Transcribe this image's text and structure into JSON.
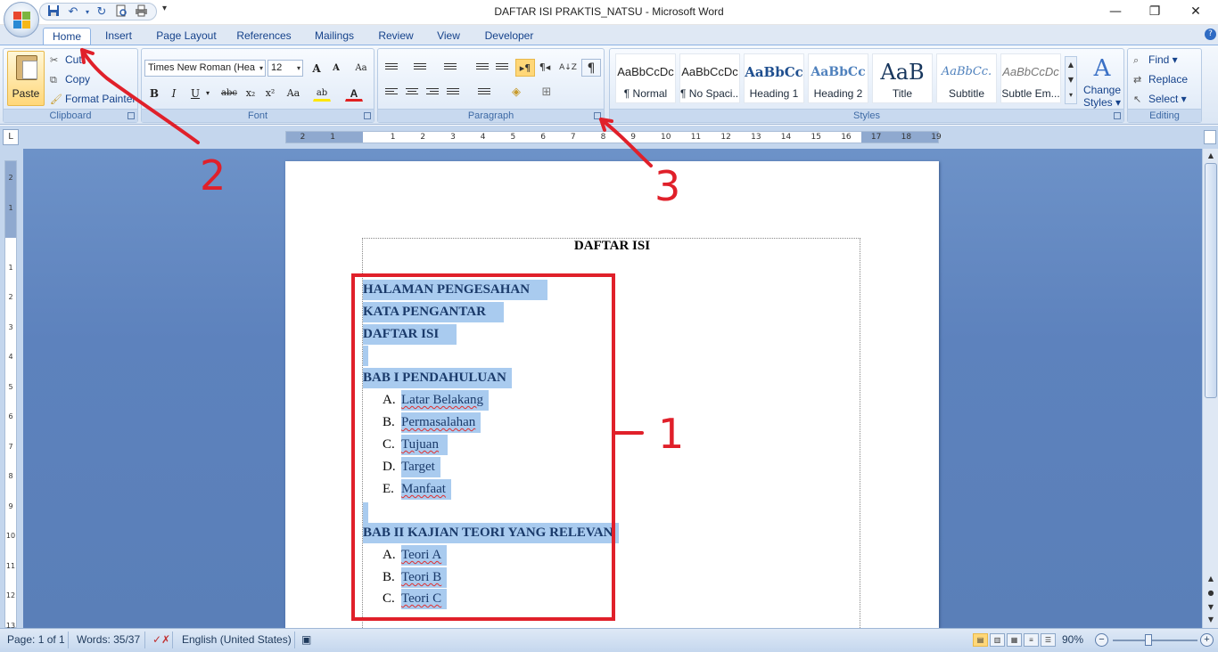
{
  "window": {
    "title": "DAFTAR ISI PRAKTIS_NATSU - Microsoft Word",
    "minimize": "—",
    "restore": "❐",
    "close": "✕"
  },
  "qat": {
    "save_icon": "save-icon",
    "undo_icon": "undo-icon",
    "redo_icon": "redo-icon",
    "print_preview_icon": "print-preview-icon",
    "print_icon": "print-icon",
    "customize": "▾"
  },
  "tabs": [
    {
      "label": "Home"
    },
    {
      "label": "Insert"
    },
    {
      "label": "Page Layout"
    },
    {
      "label": "References"
    },
    {
      "label": "Mailings"
    },
    {
      "label": "Review"
    },
    {
      "label": "View"
    },
    {
      "label": "Developer"
    }
  ],
  "help": "?",
  "ribbon": {
    "clipboard": {
      "label": "Clipboard",
      "paste": "Paste",
      "cut": "Cut",
      "copy": "Copy",
      "format_painter": "Format Painter"
    },
    "font": {
      "label": "Font",
      "font_name": "Times New Roman (Hea",
      "font_size": "12",
      "grow": "A",
      "shrink": "A",
      "clear": "Aa",
      "bold": "B",
      "italic": "I",
      "underline": "U",
      "strike": "abc",
      "subscript": "x₂",
      "superscript": "x²",
      "change_case": "Aa",
      "highlight": "ab",
      "font_color": "A"
    },
    "paragraph": {
      "label": "Paragraph",
      "show_marks": "¶",
      "sort": "A↓Z"
    },
    "styles": {
      "label": "Styles",
      "items": [
        {
          "sample": "AaBbCcDc",
          "name": "¶ Normal"
        },
        {
          "sample": "AaBbCcDc",
          "name": "¶ No Spaci..."
        },
        {
          "sample": "AaBbCc",
          "name": "Heading 1"
        },
        {
          "sample": "AaBbCc",
          "name": "Heading 2"
        },
        {
          "sample": "AaB",
          "name": "Title"
        },
        {
          "sample": "AaBbCc.",
          "name": "Subtitle"
        },
        {
          "sample": "AaBbCcDc",
          "name": "Subtle Em..."
        }
      ],
      "change_styles_line1": "Change",
      "change_styles_line2": "Styles ▾"
    },
    "editing": {
      "label": "Editing",
      "find": "Find ▾",
      "replace": "Replace",
      "select": "Select ▾"
    }
  },
  "ruler": {
    "tab_selector": "L",
    "h_numbers": [
      "2",
      "1",
      "1",
      "2",
      "3",
      "4",
      "5",
      "6",
      "7",
      "8",
      "9",
      "10",
      "11",
      "12",
      "13",
      "14",
      "15",
      "16",
      "17",
      "18",
      "19"
    ],
    "v_numbers": [
      "2",
      "1",
      "1",
      "2",
      "3",
      "4",
      "5",
      "6",
      "7",
      "8",
      "9",
      "10",
      "11",
      "12",
      "13",
      "14"
    ]
  },
  "document": {
    "title": "DAFTAR ISI",
    "lines": [
      {
        "text": "HALAMAN PENGESAHAN"
      },
      {
        "text": "KATA PENGANTAR"
      },
      {
        "text": "DAFTAR ISI"
      },
      {
        "text": "BAB I PENDAHULUAN"
      },
      {
        "text": "BAB II KAJIAN TEORI YANG RELEVAN"
      }
    ],
    "bab1_items": [
      {
        "marker": "A.",
        "text": "Latar Belakang"
      },
      {
        "marker": "B.",
        "text": "Permasalahan"
      },
      {
        "marker": "C.",
        "text": "Tujuan"
      },
      {
        "marker": "D.",
        "text": "Target"
      },
      {
        "marker": "E.",
        "text": "Manfaat"
      }
    ],
    "bab2_items": [
      {
        "marker": "A.",
        "text": "Teori A"
      },
      {
        "marker": "B.",
        "text": "Teori B"
      },
      {
        "marker": "C.",
        "text": "Teori C"
      }
    ]
  },
  "annotations": {
    "one": "1",
    "two": "2",
    "three": "3",
    "color": "#e0202a"
  },
  "status": {
    "page": "Page: 1 of 1",
    "words": "Words: 35/37",
    "language": "English (United States)",
    "zoom": "90%",
    "zoom_out": "−",
    "zoom_in": "+"
  },
  "colors": {
    "selection": "#a9cbef",
    "ribbon_text": "#15428b",
    "canvas": "#6d92c8"
  }
}
